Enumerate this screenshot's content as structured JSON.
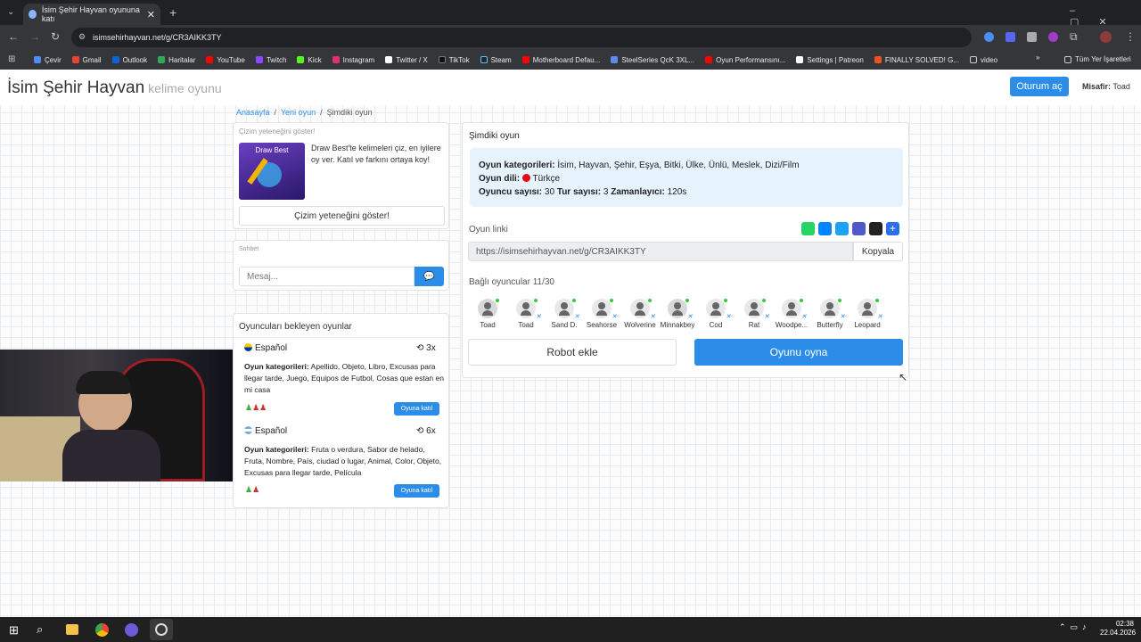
{
  "browser": {
    "tab_title": "İsim Şehir Hayvan oyununa katı",
    "url": "isimsehirhayvan.net/g/CR3AIKK3TY",
    "bookmarks": [
      "Çevir",
      "Gmail",
      "Outlook",
      "Haritalar",
      "YouTube",
      "Twitch",
      "Kick",
      "Instagram",
      "Twitter / X",
      "TikTok",
      "Steam",
      "Motherboard Defau...",
      "SteelSeries QcK 3XL...",
      "Oyun Performansını...",
      "Settings | Patreon",
      "FINALLY SOLVED! G...",
      "video"
    ],
    "all_bookmarks": "Tüm Yer İşaretleri"
  },
  "nav": {
    "brand": "İsim Şehir Hayvan",
    "brand_sub": "kelime oyunu",
    "login": "Oturum aç",
    "guest_label": "Misafir:",
    "guest_name": "Toad"
  },
  "breadcrumb": {
    "home": "Anasayfa",
    "new": "Yeni oyun",
    "current": "Şimdiki oyun"
  },
  "draw": {
    "title": "Çizim yeteneğini göster!",
    "thumb": "Draw Best",
    "text": "Draw Best'te kelimeleri çiz, en iyilere oy ver. Katıl ve farkını ortaya koy!",
    "button": "Çizim yeteneğini göster!"
  },
  "chat": {
    "title": "Sohbet",
    "placeholder": "Mesaj..."
  },
  "waiting": {
    "title": "Oyuncuları bekleyen oyunlar",
    "cat_label": "Oyun kategorileri:",
    "join": "Oyuna katıl",
    "games": [
      {
        "lang": "Español",
        "rounds": "3x",
        "cats": "Apellido, Objeto, Libro, Excusas para llegar tarde, Juego, Equipos de Futbol, Cosas que estan en mi casa",
        "players": 3
      },
      {
        "lang": "Español",
        "rounds": "6x",
        "cats": "Fruta o verdura, Sabor de helado, Fruta, Nombre, País, ciudad o lugar, Animal, Color, Objeto, Excusas para llegar tarde, Película",
        "players": 2
      }
    ]
  },
  "current": {
    "title": "Şimdiki oyun",
    "cat_label": "Oyun kategorileri:",
    "cats": "İsim, Hayvan, Şehir, Eşya, Bitki, Ülke, Ünlü, Meslek, Dizi/Film",
    "lang_label": "Oyun dili:",
    "lang": "Türkçe",
    "players_label": "Oyuncu sayısı:",
    "players": "30",
    "rounds_label": "Tur sayısı:",
    "rounds": "3",
    "timer_label": "Zamanlayıcı:",
    "timer": "120s",
    "link_label": "Oyun linki",
    "link": "https://isimsehirhayvan.net/g/CR3AIKK3TY",
    "copy": "Kopyala",
    "connected": "Bağlı oyuncular 11/30",
    "players_list": [
      "Toad",
      "Toad",
      "Sand D.",
      "Seahorse",
      "Wolverine",
      "Minnakbey",
      "Cod",
      "Rat",
      "Woodpe...",
      "Butterfly",
      "Leopard"
    ],
    "add_robot": "Robot ekle",
    "play": "Oyunu oyna"
  },
  "taskbar": {
    "time": "02:38",
    "date": "22.04.2026"
  },
  "colors": {
    "accent": "#2c8de8",
    "info_bg": "#e6f3fd",
    "online": "#33cc33"
  }
}
